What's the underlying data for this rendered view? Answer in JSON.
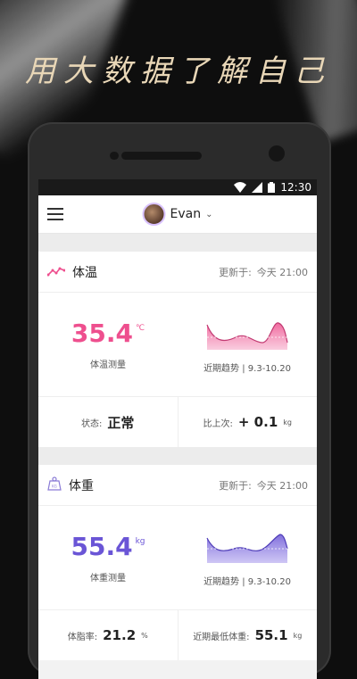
{
  "headline": "用大数据了解自己",
  "status_bar": {
    "time": "12:30"
  },
  "app_bar": {
    "user_name": "Evan"
  },
  "cards": [
    {
      "title": "体温",
      "updated_label": "更新于:",
      "updated_time": "今天 21:00",
      "value": "35.4",
      "unit": "℃",
      "value_caption": "体温测量",
      "trend_caption": "近期趋势 | 9.3-10.20",
      "foot_left_label": "状态:",
      "foot_left_value": "正常",
      "foot_right_label": "比上次:",
      "foot_right_value": "+ 0.1",
      "foot_right_unit": "kg",
      "color": "#ee4f8e"
    },
    {
      "title": "体重",
      "updated_label": "更新于:",
      "updated_time": "今天 21:00",
      "value": "55.4",
      "unit": "kg",
      "value_caption": "体重测量",
      "trend_caption": "近期趋势 | 9.3-10.20",
      "foot_left_label": "体脂率:",
      "foot_left_value": "21.2",
      "foot_left_unit": "%",
      "foot_right_label": "近期最低体重:",
      "foot_right_value": "55.1",
      "foot_right_unit": "kg",
      "color": "#6a55d6"
    }
  ]
}
